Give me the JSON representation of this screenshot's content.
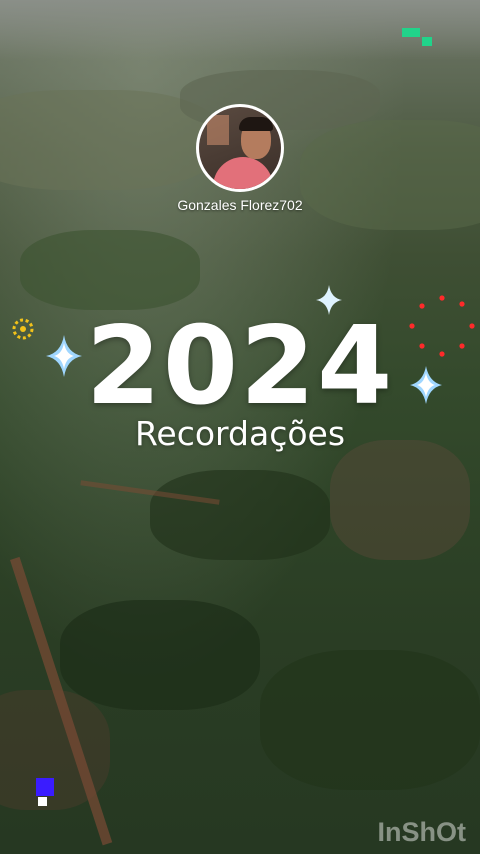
{
  "profile": {
    "username": "Gonzales Florez702"
  },
  "title": {
    "year": "2024",
    "subtitle": "Recordações"
  },
  "watermark": {
    "text": "InShOt"
  },
  "icons": {
    "avatar": "profile-photo",
    "sparkles": [
      "four-point-star-icon",
      "four-point-star-icon",
      "four-point-star-icon"
    ],
    "sun_ring": "dotted-circle-icon",
    "dot_cluster": "red-dot-ring-icon",
    "pixels": [
      "green-pixel-icon",
      "blue-white-pixel-icon"
    ]
  },
  "colors": {
    "text": "#ffffff",
    "sparkle_core": "#ffffff",
    "sparkle_glow": "#9fd6ff",
    "dot_ring": "#ff2a2a",
    "sun_ring": "#f2c21a",
    "pixel_green": "#21d38a",
    "pixel_blue": "#3a1cff"
  }
}
